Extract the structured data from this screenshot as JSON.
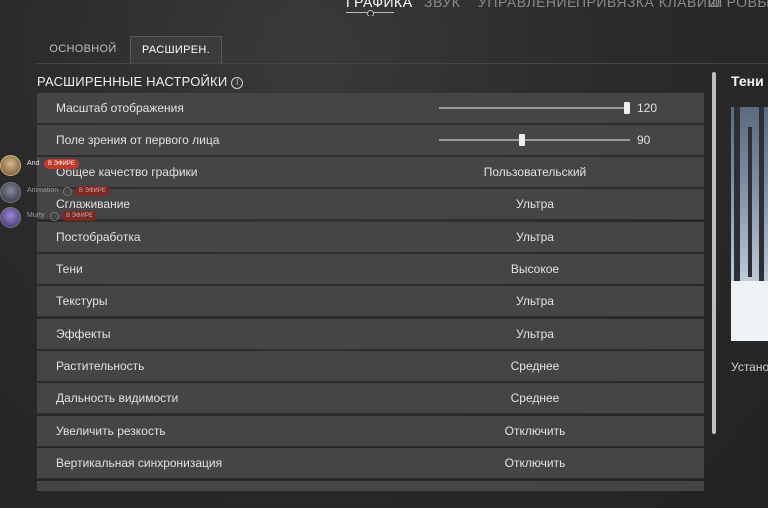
{
  "top_tabs": [
    "ГРАФИКА",
    "ЗВУК",
    "УПРАВЛЕНИЕ",
    "ПРИВЯЗКА КЛАВИШ",
    "ИГРОВЫЕ П"
  ],
  "sub_tabs": {
    "basic": "ОСНОВНОЙ",
    "advanced": "РАСШИРЕН."
  },
  "section_title": "РАСШИРЕННЫЕ НАСТРОЙКИ",
  "info_icon": "i",
  "sliders": [
    {
      "label": "Масштаб отображения",
      "value": "120",
      "fill": 1.0
    },
    {
      "label": "Поле зрения от первого лица",
      "value": "90",
      "fill": 0.43
    }
  ],
  "settings": [
    {
      "label": "Общее качество графики",
      "value": "Пользовательский"
    },
    {
      "label": "Сглаживание",
      "value": "Ультра"
    },
    {
      "label": "Постобработка",
      "value": "Ультра"
    },
    {
      "label": "Тени",
      "value": "Высокое"
    },
    {
      "label": "Текстуры",
      "value": "Ультра"
    },
    {
      "label": "Эффекты",
      "value": "Ультра"
    },
    {
      "label": "Растительность",
      "value": "Среднее"
    },
    {
      "label": "Дальность видимости",
      "value": "Среднее"
    },
    {
      "label": "Увеличить резкость",
      "value": "Отключить"
    },
    {
      "label": "Вертикальная синхронизация",
      "value": "Отключить"
    }
  ],
  "preview": {
    "title": "Тени",
    "description": "Устано"
  },
  "streamers": [
    {
      "name": "And",
      "live": "В ЭФИРЕ"
    },
    {
      "name": "Animation",
      "live": "В ЭФИРЕ"
    },
    {
      "name": "Murty",
      "live": "В ЭФИРЕ"
    }
  ]
}
